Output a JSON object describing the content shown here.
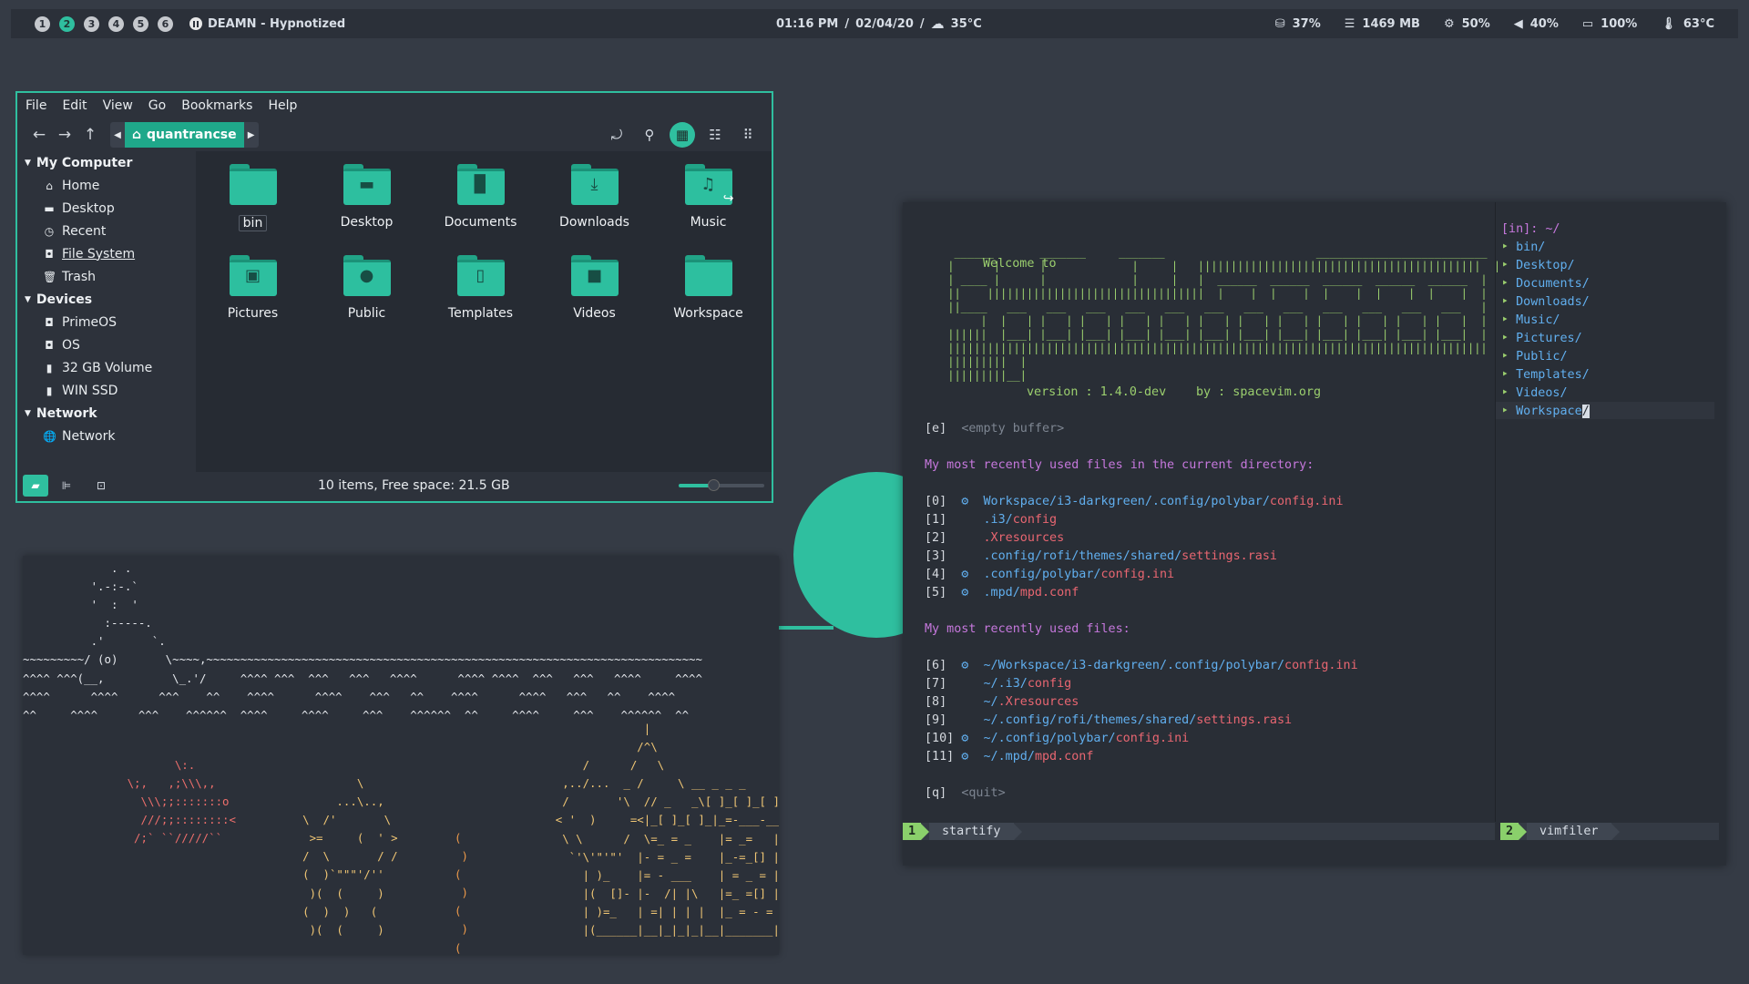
{
  "colors": {
    "accent": "#2fbf9f",
    "desktop": "#353b45",
    "bar": "#2b3039"
  },
  "topbar": {
    "workspaces": [
      "1",
      "2",
      "3",
      "4",
      "5",
      "6"
    ],
    "active_workspace": "2",
    "now_playing": "DEAMN - Hypnotized",
    "time": "01:16 PM",
    "date": "02/04/20",
    "weather": "35°C",
    "separator": "/",
    "disk": "37%",
    "memory": "1469 MB",
    "cpu": "50%",
    "volume": "40%",
    "battery": "100%",
    "temperature": "63°C"
  },
  "file_manager": {
    "menu": [
      "File",
      "Edit",
      "View",
      "Go",
      "Bookmarks",
      "Help"
    ],
    "path": "quantrancse",
    "sidebar": {
      "my_computer": "My Computer",
      "my_computer_items": [
        "Home",
        "Desktop",
        "Recent",
        "File System",
        "Trash"
      ],
      "devices": "Devices",
      "devices_items": [
        "PrimeOS",
        "OS",
        "32 GB Volume",
        "WIN SSD"
      ],
      "network": "Network",
      "network_items": [
        "Network"
      ]
    },
    "files": [
      "bin",
      "Desktop",
      "Documents",
      "Downloads",
      "Music",
      "Pictures",
      "Public",
      "Templates",
      "Videos",
      "Workspace"
    ],
    "status": "10 items, Free space: 21.5 GB",
    "zoom_level": 0.4
  },
  "ascii_art": {
    "white_scene": "             . .\n          '.-:-.`\n          '  :  '\n            :-----.\n          .'       `.\n~~~~~~~~~/ (o)       \\~~~~,~~~~~~~~~~~~~~~~~~~~~~~~~~~~~~~~~~~~~~~~~~~~~~~~~~~~~~~~~~~~~~~~~~~~~~~~~\n^^^^ ^^^(__,          \\_.'/     ^^^^ ^^^  ^^^   ^^^   ^^^^      ^^^^ ^^^^  ^^^   ^^^   ^^^^     ^^^^\n^^^^      ^^^^      ^^^    ^^    ^^^^      ^^^^    ^^^   ^^    ^^^^      ^^^^   ^^^   ^^    ^^^^\n^^     ^^^^      ^^^    ^^^^^^  ^^^^     ^^^^     ^^^    ^^^^^^  ^^     ^^^^     ^^^    ^^^^^^  ^^",
    "red_fish": "                 \\:.\n          \\;,   ,;\\\\\\,,\n            \\\\\\;;:::::::o\n            ///;;::::::::<\n           /;` ``/////``",
    "yellow_figure": "                 \\\n              ...\\..,\n         \\  /'       \\\n          >=     (  ' >\n         /  \\       / /\n         (  )`\"\"\"'/''\n          )(  (     )\n         (  )  )   (\n          )(  (     )",
    "orange_wave": "(\n )\n(\n )\n(\n )\n(",
    "castle": "                   |\n                  /^\\\n          /      /   \\\n       ,../...  _ /     \\ __ _ _ _\n       /       '\\  // _   _\\[ ]_[ ]_[ ]\n      < '  )     =<|_[ ]_[ ]_|_=-___-__|\n       \\ \\      /  \\=_ = _    |= _=   |\n        `'\\'\"'\"'  |- = _ =    |_-=_[] |\n          | )_    |= - ___    | = _ = |\n          |(  []- |-  /| |\\   |=_ =[] |\n          | )=_   | =| | | |  |_ = - = |\n          |(______|__|_|_|_|__|_______|"
  },
  "vim": {
    "welcome": "Welcome to",
    "banner": "  ______       _______     _______                       __________________________\n |      |      |             |     |   |||||||||||||||||||||||||||||||||||||||||||  |\n | ____ |      |             |     |   |  ______  ______  ______  ______  ______  | \n ||    |||||||||||||||||||||||||||||||||  |    |  |    |  |    |  |    |  |    |  | \n ||____   ___   ___   ___   ___   ___   ___   ___   ___   ___   ___   ___   ___   | \n      |  |   | |   | |   | |   | |   | |   | |   | |   | |   | |   | |   | |   |  | \n ||||||  |___| |___| |___| |___| |___| |___| |___| |___| |___| |___| |___| |___|  | \n |||||||||||||||||||||||||||||||||||||||||||||||||||||||||||||||||||||||||||||||||| \n |||||||||  |\n |||||||||__|",
    "version": "version : 1.4.0-dev",
    "by": "by : spacevim.org",
    "empty_key": "[e]",
    "empty_label": "<empty buffer>",
    "recent_dir_heading": "My most recently used files in the current directory:",
    "recent_dir": [
      {
        "key": "[0]",
        "icon": true,
        "parts": [
          [
            "b",
            "Workspace/i3-darkgreen/.config/polybar/"
          ],
          [
            "r",
            "config.ini"
          ]
        ]
      },
      {
        "key": "[1]",
        "icon": false,
        "parts": [
          [
            "b",
            ".i3/"
          ],
          [
            "r",
            "config"
          ]
        ]
      },
      {
        "key": "[2]",
        "icon": false,
        "parts": [
          [
            "r",
            ".Xresources"
          ]
        ]
      },
      {
        "key": "[3]",
        "icon": false,
        "parts": [
          [
            "b",
            ".config/rofi/themes/shared/"
          ],
          [
            "r",
            "settings.rasi"
          ]
        ]
      },
      {
        "key": "[4]",
        "icon": true,
        "parts": [
          [
            "b",
            ".config/polybar/"
          ],
          [
            "r",
            "config.ini"
          ]
        ]
      },
      {
        "key": "[5]",
        "icon": true,
        "parts": [
          [
            "b",
            ".mpd/"
          ],
          [
            "r",
            "mpd.conf"
          ]
        ]
      }
    ],
    "recent_heading": "My most recently used files:",
    "recent": [
      {
        "key": "[6]",
        "icon": true,
        "parts": [
          [
            "b",
            "~/Workspace/i3-darkgreen/.config/polybar/"
          ],
          [
            "r",
            "config.ini"
          ]
        ]
      },
      {
        "key": "[7]",
        "icon": false,
        "parts": [
          [
            "b",
            "~/.i3/"
          ],
          [
            "r",
            "config"
          ]
        ]
      },
      {
        "key": "[8]",
        "icon": false,
        "parts": [
          [
            "b",
            "~/"
          ],
          [
            "r",
            ".Xresources"
          ]
        ]
      },
      {
        "key": "[9]",
        "icon": false,
        "parts": [
          [
            "b",
            "~/.config/rofi/themes/shared/"
          ],
          [
            "r",
            "settings.rasi"
          ]
        ]
      },
      {
        "key": "[10]",
        "icon": true,
        "parts": [
          [
            "b",
            "~/.config/polybar/"
          ],
          [
            "r",
            "config.ini"
          ]
        ]
      },
      {
        "key": "[11]",
        "icon": true,
        "parts": [
          [
            "b",
            "~/.mpd/"
          ],
          [
            "r",
            "mpd.conf"
          ]
        ]
      }
    ],
    "quit_key": "[q]",
    "quit_label": "<quit>",
    "tree_root": "[in]: ~/",
    "tree": [
      "bin/",
      "Desktop/",
      "Documents/",
      "Downloads/",
      "Music/",
      "Pictures/",
      "Public/",
      "Templates/",
      "Videos/",
      "Workspace/"
    ],
    "status_left_num": "1",
    "status_left_name": "startify",
    "status_right_num": "2",
    "status_right_name": "vimfiler"
  }
}
